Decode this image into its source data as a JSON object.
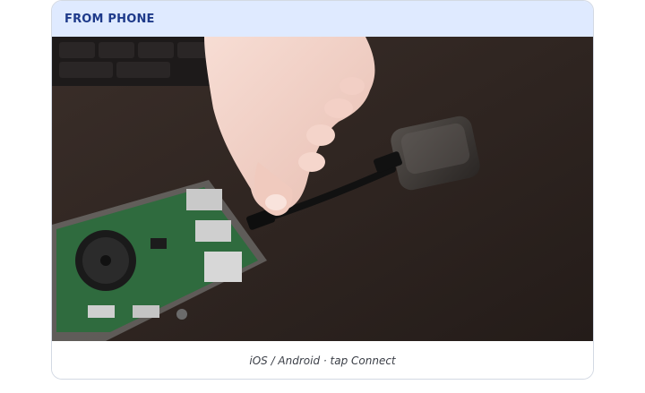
{
  "card": {
    "title": "FROM PHONE",
    "caption": "iOS / Android · tap Connect"
  },
  "photo": {
    "subject": "hand plugging usb dongle into single-board computer",
    "icons": [
      "single-board-computer-icon",
      "usb-dongle-icon",
      "hand-icon"
    ]
  },
  "colors": {
    "header_bg": "#dfeaff",
    "title": "#1e3a8a",
    "caption": "#3b3f47",
    "border": "#d3d9e3"
  }
}
